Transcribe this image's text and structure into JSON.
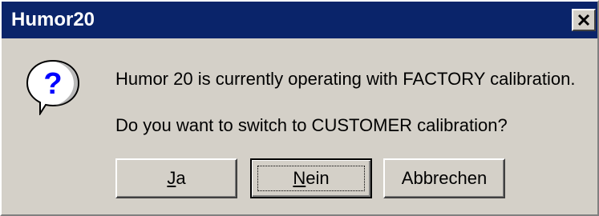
{
  "window": {
    "title": "Humor20",
    "close_symbol": "✕"
  },
  "message": {
    "icon": "question-icon",
    "line1": "Humor 20 is currently operating with FACTORY calibration.",
    "line2": "Do you want to switch to CUSTOMER calibration?"
  },
  "buttons": {
    "yes": {
      "mnemonic": "J",
      "rest": "a"
    },
    "no": {
      "mnemonic": "N",
      "rest": "ein"
    },
    "cancel": {
      "label": "Abbrechen"
    }
  },
  "colors": {
    "titlebar": "#0a246a",
    "face": "#d4d0c8",
    "title_text": "#ffffff"
  }
}
